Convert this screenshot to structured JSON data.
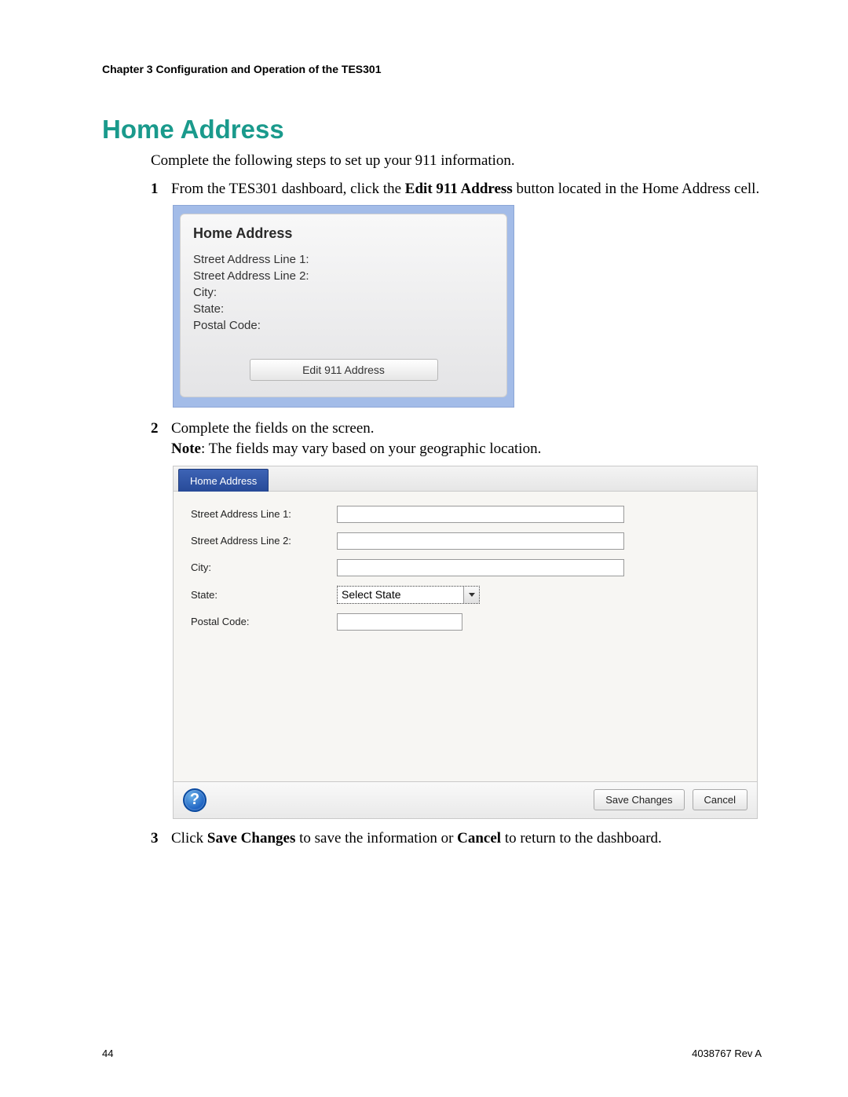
{
  "header": {
    "chapter": "Chapter 3    Configuration and Operation of the TES301"
  },
  "section": {
    "title": "Home Address",
    "intro": "Complete the following steps to set up your 911 information."
  },
  "steps": {
    "s1": {
      "num": "1",
      "pre": "From the TES301 dashboard, click the ",
      "bold": "Edit 911 Address",
      "post": " button located in the Home Address cell."
    },
    "s2": {
      "num": "2",
      "line1": "Complete the fields on the screen.",
      "note_label": "Note",
      "note_text": ": The fields may vary based on your geographic location."
    },
    "s3": {
      "num": "3",
      "pre": "Click ",
      "bold1": "Save Changes",
      "mid": " to save the information or ",
      "bold2": "Cancel",
      "post": " to return to the dashboard."
    }
  },
  "card": {
    "title": "Home Address",
    "lines": {
      "l1": "Street Address Line 1:",
      "l2": "Street Address Line 2:",
      "l3": "City:",
      "l4": "State:",
      "l5": "Postal Code:"
    },
    "button": "Edit 911 Address"
  },
  "form": {
    "tab": "Home Address",
    "labels": {
      "street1": "Street Address Line 1:",
      "street2": "Street Address Line 2:",
      "city": "City:",
      "state": "State:",
      "postal": "Postal Code:"
    },
    "state_selected": "Select State",
    "help_glyph": "?",
    "save": "Save Changes",
    "cancel": "Cancel"
  },
  "footer": {
    "page": "44",
    "rev": "4038767 Rev A"
  }
}
